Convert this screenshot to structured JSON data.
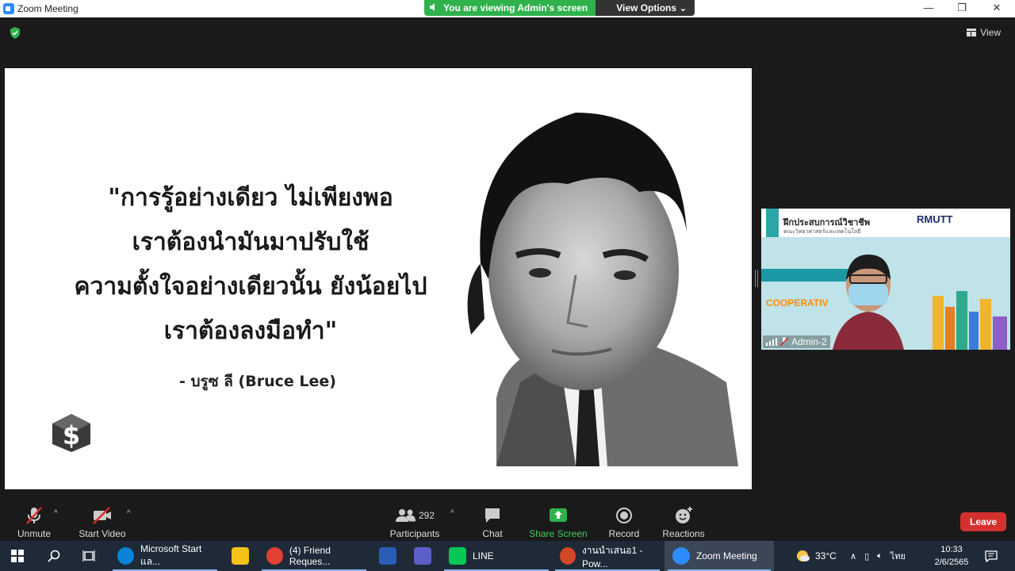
{
  "window": {
    "title": "Zoom Meeting",
    "minimize": "—",
    "restore": "❐",
    "close": "✕"
  },
  "share_banner": {
    "status": "You are viewing Admin's screen",
    "view_options": "View Options"
  },
  "top_right": {
    "view_label": "View"
  },
  "slide": {
    "quote_lines": [
      "\"การรู้อย่างเดียว ไม่เพียงพอ",
      "เราต้องนำมันมาปรับใช้",
      "ความตั้งใจอย่างเดียวนั้น ยังน้อยไป",
      "เราต้องลงมือทำ\""
    ],
    "author": "- บรูซ ลี (Bruce Lee)"
  },
  "video_tile": {
    "header_title": "ฝึกประสบการณ์วิชาชีพ",
    "header_subtitle": "คณะวิทยาศาสตร์และเทคโนโลยี",
    "brand": "RMUTT",
    "coop_text": "COOPERATIV",
    "participant_name": "Admin-2"
  },
  "toolbar": {
    "unmute": "Unmute",
    "start_video": "Start Video",
    "participants": "Participants",
    "participant_count": "292",
    "chat": "Chat",
    "share_screen": "Share Screen",
    "record": "Record",
    "reactions": "Reactions",
    "leave": "Leave"
  },
  "taskbar": {
    "items": [
      {
        "label": "Microsoft Start แล...",
        "color": "#0a84d6"
      },
      {
        "label": "",
        "color": "#f3c318"
      },
      {
        "label": "(4) Friend Reques...",
        "color": "#e34133"
      },
      {
        "label": "",
        "color": "#2b5cb8"
      },
      {
        "label": "",
        "color": "#5b5fc7"
      },
      {
        "label": "LINE",
        "color": "#06c755"
      },
      {
        "label": "งานนำเสนอ1 - Pow...",
        "color": "#d24726"
      },
      {
        "label": "Zoom Meeting",
        "color": "#2d8cff"
      }
    ],
    "weather": "33°C",
    "language": "ไทย",
    "time": "10:33",
    "date": "2/6/2565"
  },
  "colors": {
    "share_green": "#2fb24c",
    "leave_red": "#d3312f",
    "zoom_blue": "#2d8cff"
  }
}
